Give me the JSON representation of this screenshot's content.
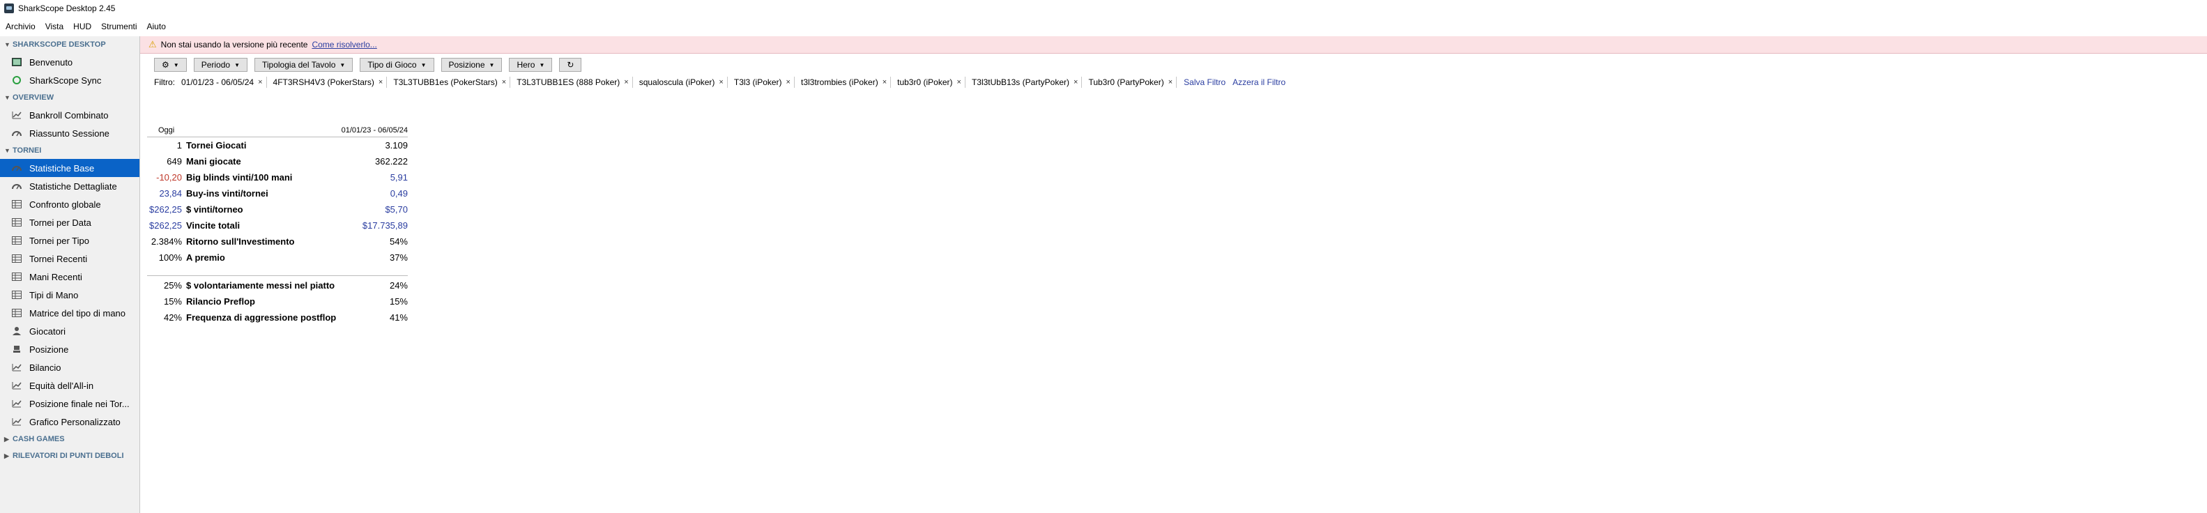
{
  "app": {
    "title": "SharkScope Desktop 2.45"
  },
  "menu": [
    "Archivio",
    "Vista",
    "HUD",
    "Strumenti",
    "Aiuto"
  ],
  "sidebar": {
    "sections": [
      {
        "title": "SHARKSCOPE DESKTOP",
        "items": [
          {
            "label": "Benvenuto",
            "icon": "image-icon"
          },
          {
            "label": "SharkScope Sync",
            "icon": "sync-icon"
          }
        ]
      },
      {
        "title": "OVERVIEW",
        "items": [
          {
            "label": "Bankroll Combinato",
            "icon": "line-chart-icon"
          },
          {
            "label": "Riassunto Sessione",
            "icon": "gauge-icon"
          }
        ]
      },
      {
        "title": "TORNEI",
        "items": [
          {
            "label": "Statistiche Base",
            "icon": "gauge-icon",
            "active": true
          },
          {
            "label": "Statistiche Dettagliate",
            "icon": "gauge-icon"
          },
          {
            "label": "Confronto globale",
            "icon": "table-icon"
          },
          {
            "label": "Tornei per Data",
            "icon": "table-icon"
          },
          {
            "label": "Tornei per Tipo",
            "icon": "table-icon"
          },
          {
            "label": "Tornei Recenti",
            "icon": "table-icon"
          },
          {
            "label": "Mani Recenti",
            "icon": "table-icon"
          },
          {
            "label": "Tipi di Mano",
            "icon": "table-icon"
          },
          {
            "label": "Matrice del tipo di mano",
            "icon": "table-icon"
          },
          {
            "label": "Giocatori",
            "icon": "user-icon"
          },
          {
            "label": "Posizione",
            "icon": "seat-icon"
          },
          {
            "label": "Bilancio",
            "icon": "line-chart-icon"
          },
          {
            "label": "Equità dell'All-in",
            "icon": "line-chart-icon"
          },
          {
            "label": "Posizione finale nei Tor...",
            "icon": "line-chart-icon"
          },
          {
            "label": "Grafico Personalizzato",
            "icon": "line-chart-icon"
          }
        ]
      },
      {
        "title": "CASH GAMES",
        "items": []
      },
      {
        "title": "RILEVATORI DI PUNTI DEBOLI",
        "items": []
      }
    ]
  },
  "notice": {
    "text": "Non stai usando la versione più recente",
    "link": "Come risolverlo..."
  },
  "toolbar": {
    "buttons": [
      "Periodo",
      "Tipologia del Tavolo",
      "Tipo di Gioco",
      "Posizione",
      "Hero"
    ]
  },
  "filter": {
    "label": "Filtro:",
    "chips": [
      "01/01/23 - 06/05/24",
      "4FT3RSH4V3 (PokerStars)",
      "T3L3TUBB1es (PokerStars)",
      "T3L3TUBB1ES (888 Poker)",
      "squaloscula (iPoker)",
      "T3l3 (iPoker)",
      "t3l3trombies (iPoker)",
      "tub3r0 (iPoker)",
      "T3l3tUbB13s (PartyPoker)",
      "Tub3r0 (PartyPoker)"
    ],
    "save": "Salva Filtro",
    "reset": "Azzera il Filtro"
  },
  "stats": {
    "col_today": "Oggi",
    "col_range": "01/01/23 - 06/05/24",
    "group1": [
      {
        "left": "1",
        "label": "Tornei Giocati",
        "right": "3.109"
      },
      {
        "left": "649",
        "label": "Mani giocate",
        "right": "362.222"
      },
      {
        "left": "-10,20",
        "label": "Big blinds vinti/100 mani",
        "right": "5,91",
        "leftClass": "neg",
        "rightClass": "blue"
      },
      {
        "left": "23,84",
        "label": "Buy-ins vinti/tornei",
        "right": "0,49",
        "leftClass": "blue",
        "rightClass": "blue"
      },
      {
        "left": "$262,25",
        "label": "$ vinti/torneo",
        "right": "$5,70",
        "leftClass": "blue",
        "rightClass": "blue"
      },
      {
        "left": "$262,25",
        "label": "Vincite totali",
        "right": "$17.735,89",
        "leftClass": "blue",
        "rightClass": "blue"
      },
      {
        "left": "2.384%",
        "label": "Ritorno sull'Investimento",
        "right": "54%"
      },
      {
        "left": "100%",
        "label": "A premio",
        "right": "37%"
      }
    ],
    "group2": [
      {
        "left": "25%",
        "label": "$ volontariamente messi nel piatto",
        "right": "24%"
      },
      {
        "left": "15%",
        "label": "Rilancio Preflop",
        "right": "15%"
      },
      {
        "left": "42%",
        "label": "Frequenza di aggressione postflop",
        "right": "41%"
      }
    ]
  }
}
